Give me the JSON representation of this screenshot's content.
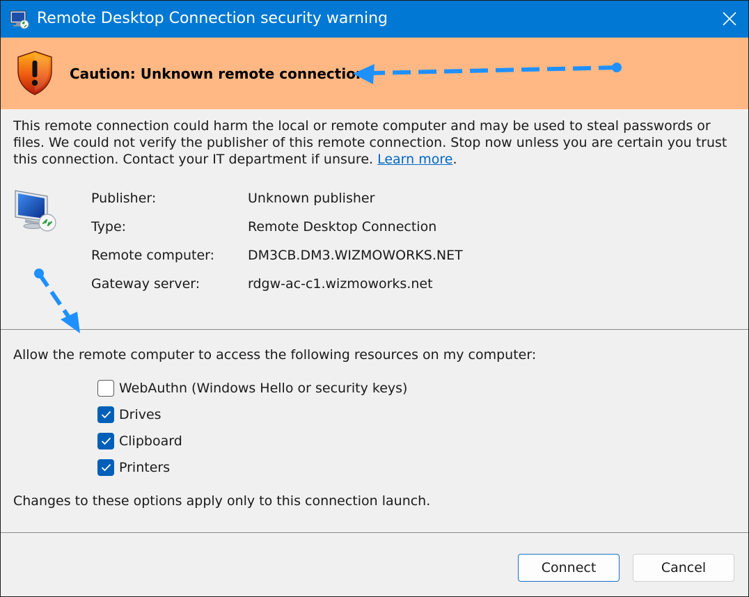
{
  "window": {
    "title": "Remote Desktop Connection security warning"
  },
  "warning": {
    "heading": "Caution: Unknown remote connection"
  },
  "message": {
    "text": "This remote connection could harm the local or remote computer and may be used to steal passwords or files. We could not verify the publisher of this remote connection. Stop now unless you are certain you trust this connection. Contact your IT department if unsure. ",
    "link": "Learn more",
    "suffix": "."
  },
  "details": [
    {
      "label": "Publisher:",
      "value": "Unknown publisher"
    },
    {
      "label": "Type:",
      "value": "Remote Desktop Connection"
    },
    {
      "label": "Remote computer:",
      "value": "DM3CB.DM3.WIZMOWORKS.NET"
    },
    {
      "label": "Gateway server:",
      "value": "rdgw-ac-c1.wizmoworks.net"
    }
  ],
  "resources": {
    "title": "Allow the remote computer to access the following resources on my computer:",
    "items": [
      {
        "label": "WebAuthn (Windows Hello or security keys)",
        "checked": false
      },
      {
        "label": "Drives",
        "checked": true
      },
      {
        "label": "Clipboard",
        "checked": true
      },
      {
        "label": "Printers",
        "checked": true
      }
    ],
    "note": "Changes to these options apply only to this connection launch."
  },
  "buttons": {
    "connect": "Connect",
    "cancel": "Cancel"
  },
  "colors": {
    "titlebar": "#0078d4",
    "warning_band": "#ffb883",
    "accent": "#005fb8",
    "annotation_arrow": "#1e90ff"
  },
  "icons": [
    "remote-desktop-app-icon",
    "close-icon",
    "warning-shield-icon",
    "remote-computer-icon",
    "checkmark-icon"
  ]
}
